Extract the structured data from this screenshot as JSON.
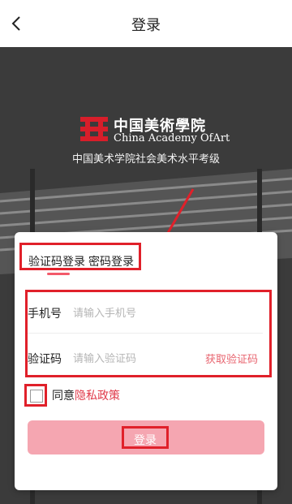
{
  "header": {
    "title": "登录",
    "back_icon": "chevron-left-icon"
  },
  "logo": {
    "name_cn": "中国美術學院",
    "name_en": "China Academy OfArt",
    "subtitle": "中国美术学院社会美术水平考级"
  },
  "login": {
    "tabs": [
      {
        "label": "验证码登录",
        "active": true
      },
      {
        "label": "密码登录",
        "active": false
      }
    ],
    "phone": {
      "label": "手机号",
      "placeholder": "请输入手机号",
      "value": ""
    },
    "code": {
      "label": "验证码",
      "placeholder": "请输入验证码",
      "value": "",
      "action": "获取验证码"
    },
    "agree": {
      "prefix": "同意",
      "link": "隐私政策",
      "checked": false
    },
    "submit": "登录"
  },
  "colors": {
    "accent": "#e8646f",
    "button": "#f5a6b1",
    "highlight": "#e0202a"
  }
}
